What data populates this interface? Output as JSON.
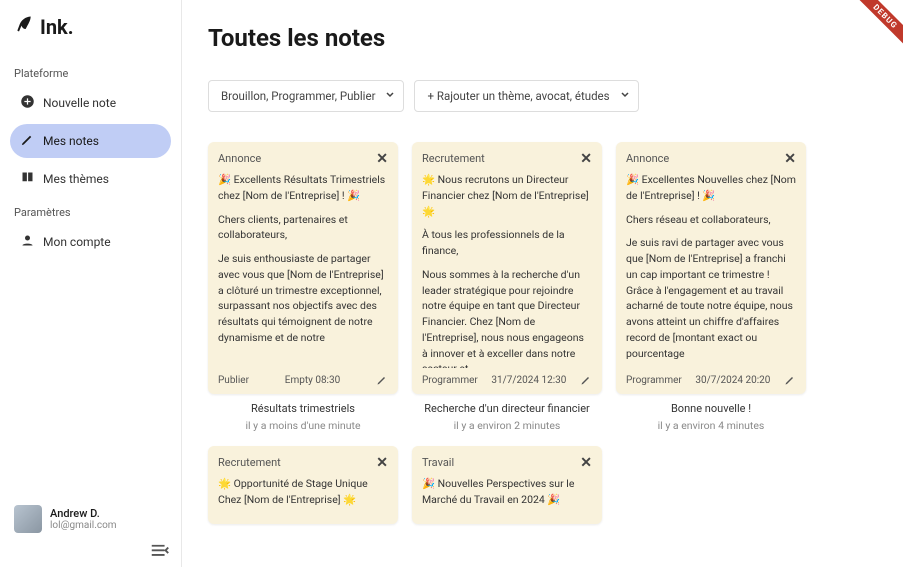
{
  "debug_label": "DEBUG",
  "brand": "Ink.",
  "sidebar": {
    "section_platform": "Plateforme",
    "section_settings": "Paramètres",
    "new_note": "Nouvelle note",
    "my_notes": "Mes notes",
    "my_themes": "Mes thèmes",
    "my_account": "Mon compte"
  },
  "user": {
    "name": "Andrew D.",
    "email": "lol@gmail.com"
  },
  "page_title": "Toutes les notes",
  "filters": {
    "status": "Brouillon, Programmer, Publier",
    "themes": "+ Rajouter un thème, avocat, études"
  },
  "notes": [
    {
      "tag": "Annonce",
      "body": "🎉 Excellents Résultats Trimestriels chez [Nom de l'Entreprise] ! 🎉\n\nChers clients, partenaires et collaborateurs,\n\nJe suis enthousiaste de partager avec vous que [Nom de l'Entreprise] a clôturé un trimestre exceptionnel, surpassant nos objectifs avec des résultats qui témoignent de notre dynamisme et de notre",
      "status": "Publier",
      "meta": "Empty 08:30",
      "caption": "Résultats trimestriels",
      "time": "il y a moins d'une minute"
    },
    {
      "tag": "Recrutement",
      "body": "🌟 Nous recrutons un Directeur Financier chez [Nom de l'Entreprise] 🌟\n\nÀ tous les professionnels de la finance,\n\nNous sommes à la recherche d'un leader stratégique pour rejoindre notre équipe en tant que Directeur Financier. Chez [Nom de l'Entreprise], nous nous engageons à innover et à exceller dans notre secteur et",
      "status": "Programmer",
      "meta": "31/7/2024 12:30",
      "caption": "Recherche d'un directeur financier",
      "time": "il y a environ 2 minutes"
    },
    {
      "tag": "Annonce",
      "body": "🎉 Excellentes Nouvelles chez [Nom de l'Entreprise] ! 🎉\n\nChers réseau et collaborateurs,\n\nJe suis ravi de partager avec vous que [Nom de l'Entreprise] a franchi un cap important ce trimestre ! Grâce à l'engagement et au travail acharné de toute notre équipe, nous avons atteint un chiffre d'affaires record de [montant exact ou pourcentage",
      "status": "Programmer",
      "meta": "30/7/2024 20:20",
      "caption": "Bonne nouvelle !",
      "time": "il y a environ 4 minutes"
    },
    {
      "tag": "Recrutement",
      "body": "🌟 Opportunité de Stage Unique Chez [Nom de l'Entreprise] 🌟",
      "status": "",
      "meta": "",
      "caption": "",
      "time": ""
    },
    {
      "tag": "Travail",
      "body": "🎉 Nouvelles Perspectives sur le Marché du Travail en 2024 🎉",
      "status": "",
      "meta": "",
      "caption": "",
      "time": ""
    }
  ]
}
